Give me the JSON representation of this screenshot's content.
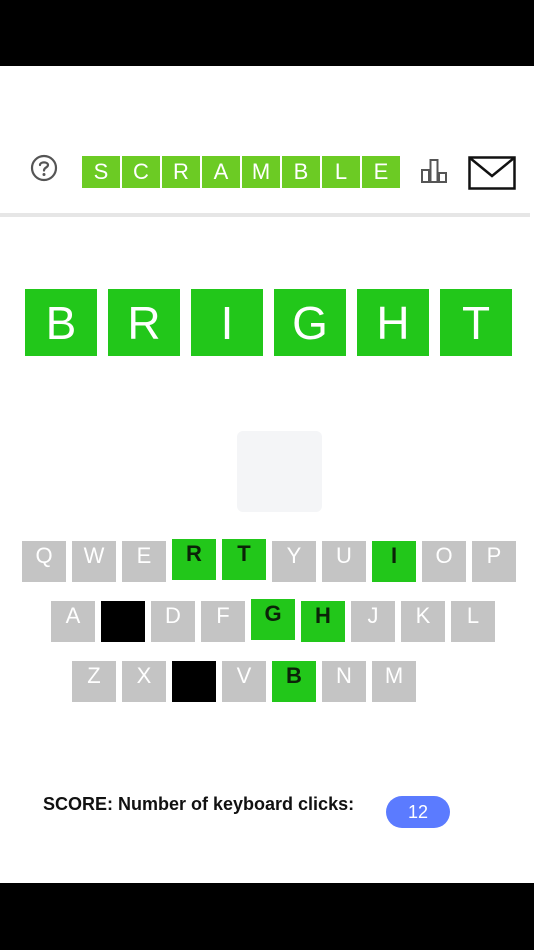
{
  "header": {
    "logo_letters": [
      "S",
      "C",
      "R",
      "A",
      "M",
      "B",
      "L",
      "E"
    ],
    "help_icon": "question-circle-icon",
    "stats_icon": "bar-chart-icon",
    "mail_icon": "envelope-icon"
  },
  "word": {
    "letters": [
      "B",
      "R",
      "I",
      "G",
      "H",
      "T"
    ]
  },
  "keyboard": {
    "row1": [
      {
        "label": "Q",
        "state": "unused"
      },
      {
        "label": "W",
        "state": "unused"
      },
      {
        "label": "E",
        "state": "unused"
      },
      {
        "label": "R",
        "state": "correct"
      },
      {
        "label": "T",
        "state": "correct"
      },
      {
        "label": "Y",
        "state": "unused"
      },
      {
        "label": "U",
        "state": "unused"
      },
      {
        "label": "I",
        "state": "correct"
      },
      {
        "label": "O",
        "state": "unused"
      },
      {
        "label": "P",
        "state": "unused"
      }
    ],
    "row2": [
      {
        "label": "A",
        "state": "unused"
      },
      {
        "label": "",
        "state": "blank"
      },
      {
        "label": "D",
        "state": "unused"
      },
      {
        "label": "F",
        "state": "unused"
      },
      {
        "label": "G",
        "state": "correct"
      },
      {
        "label": "H",
        "state": "correct"
      },
      {
        "label": "J",
        "state": "unused"
      },
      {
        "label": "K",
        "state": "unused"
      },
      {
        "label": "L",
        "state": "unused"
      }
    ],
    "row3": [
      {
        "label": "Z",
        "state": "unused"
      },
      {
        "label": "X",
        "state": "unused"
      },
      {
        "label": "",
        "state": "blank"
      },
      {
        "label": "V",
        "state": "unused"
      },
      {
        "label": "B",
        "state": "correct"
      },
      {
        "label": "N",
        "state": "unused"
      },
      {
        "label": "M",
        "state": "unused"
      }
    ]
  },
  "score": {
    "label": "SCORE: Number of keyboard clicks:",
    "value": "12"
  },
  "colors": {
    "logo_green": "#6ccb24",
    "tile_green": "#22c71a",
    "key_gray": "#c4c4c4",
    "score_blue": "#5b7bff"
  }
}
